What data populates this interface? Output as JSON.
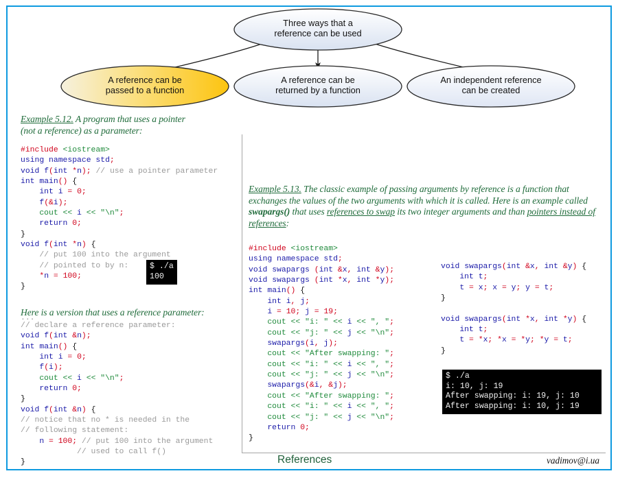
{
  "slide": {
    "border_color": "#0d9ae0",
    "background": "#ffffff"
  },
  "diagram": {
    "root": {
      "label_line1": "Three ways that a",
      "label_line2": "reference can be used",
      "fill_from": "#ffffff",
      "fill_to": "#dbe4f2"
    },
    "nodes": [
      {
        "label_line1": "A reference can be",
        "label_line2": "passed to a function",
        "fill_from": "#f7f2dd",
        "fill_to": "#fcc511",
        "highlighted": true
      },
      {
        "label_line1": "A reference can be",
        "label_line2": "returned by a function",
        "fill_from": "#ffffff",
        "fill_to": "#dbe4f2",
        "highlighted": false
      },
      {
        "label_line1": "An independent reference",
        "label_line2": "can be created",
        "fill_from": "#ffffff",
        "fill_to": "#e2e8f5",
        "highlighted": false
      }
    ]
  },
  "example_512": {
    "label": "Example 5.12.",
    "text_line1": " A program that uses a pointer",
    "text_line2": "(not a reference) as a parameter:"
  },
  "example_513": {
    "label": "Example 5.13.",
    "text_a": " The classic example of passing arguments by reference is a function that exchanges the values of the two arguments with which it is called. Here is an ",
    "text_b": "example called ",
    "bold_fn": "swapargs()",
    "text_c": " that uses ",
    "underline_a": "references to swap",
    "text_d": " its two integer arguments and than ",
    "underline_b": "pointers instead of references",
    "text_e": ":"
  },
  "reference_version_note": {
    "text": "Here is a version that uses a reference parameter:",
    "ellipsis": "..."
  },
  "code_pointer_version": {
    "lines": [
      "#include <iostream>",
      "using namespace std;",
      "void f(int *n); // use a pointer parameter",
      "int main() {",
      "    int i = 0;",
      "    f(&i);",
      "    cout << i << \"\\n\";",
      "    return 0;",
      "}",
      "void f(int *n) {",
      "    // put 100 into the argument",
      "    // pointed to by n:",
      "    *n = 100;",
      "}"
    ]
  },
  "code_reference_version": {
    "lines": [
      "// declare a reference parameter:",
      "void f(int &n);",
      "int main() {",
      "    int i = 0;",
      "    f(i);",
      "    cout << i << \"\\n\";",
      "    return 0;",
      "}",
      "void f(int &n) {",
      "// notice that no * is needed in the",
      "// following statement:",
      "    n = 100; // put 100 into the argument",
      "            // used to call f()",
      "}"
    ]
  },
  "code_swap_main": {
    "lines": [
      "#include <iostream>",
      "using namespace std;",
      "void swapargs (int &x, int &y);",
      "void swapargs (int *x, int *y);",
      "int main() {",
      "    int i, j;",
      "    i = 10; j = 19;",
      "    cout << \"i: \" << i << \", \";",
      "    cout << \"j: \" << j << \"\\n\";",
      "    swapargs(i, j);",
      "    cout << \"After swapping: \";",
      "    cout << \"i: \" << i << \", \";",
      "    cout << \"j: \" << j << \"\\n\";",
      "    swapargs(&i, &j);",
      "    cout << \"After swapping: \";",
      "    cout << \"i: \" << i << \", \";",
      "    cout << \"j: \" << j << \"\\n\";",
      "    return 0;",
      "}"
    ]
  },
  "code_swap_defs": {
    "lines": [
      "void swapargs(int &x, int &y) {",
      "    int t;",
      "    t = x; x = y; y = t;",
      "}",
      "",
      "void swapargs(int *x, int *y) {",
      "    int t;",
      "    t = *x; *x = *y; *y = t;",
      "}"
    ]
  },
  "terminal_pointer": {
    "lines": [
      "$ ./a",
      "100"
    ]
  },
  "terminal_swap": {
    "lines": [
      "$ ./a",
      "i: 10, j: 19",
      "After swapping: i: 19, j: 10",
      "After swapping: i: 10, j: 19"
    ]
  },
  "footer": {
    "title": "References",
    "email": "vadimov@i.ua"
  }
}
